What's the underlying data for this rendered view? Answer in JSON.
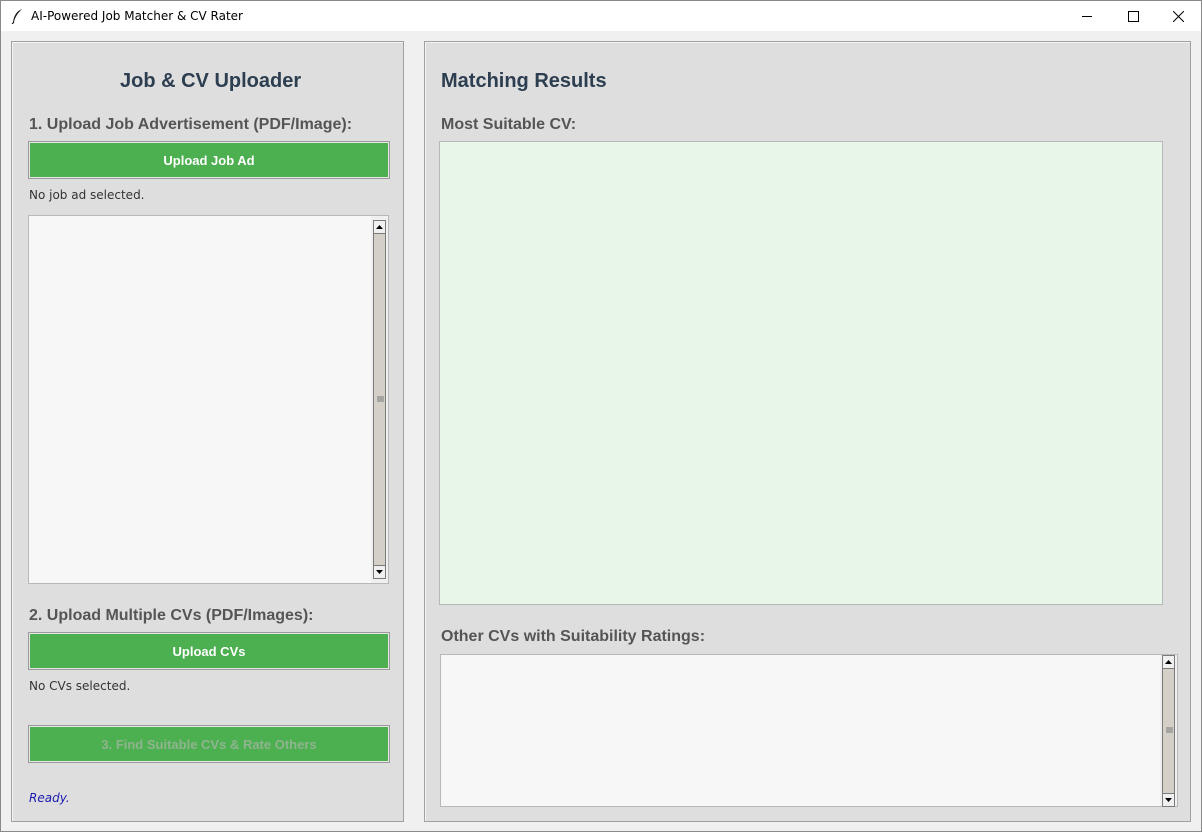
{
  "window": {
    "title": "AI-Powered Job Matcher & CV Rater",
    "app_icon": "feather-icon",
    "controls": [
      "minimize-icon",
      "maximize-icon",
      "close-icon"
    ]
  },
  "left_panel": {
    "title": "Job & CV Uploader",
    "step1_label": "1. Upload Job Advertisement (PDF/Image):",
    "upload_job_button": "Upload Job Ad",
    "job_status": "No job ad selected.",
    "job_preview_text": "",
    "step2_label": "2. Upload Multiple CVs (PDF/Images):",
    "upload_cvs_button": "Upload CVs",
    "cv_status": "No CVs selected.",
    "find_button": "3. Find Suitable CVs & Rate Others",
    "status_text": "Ready."
  },
  "right_panel": {
    "title": "Matching Results",
    "most_suitable_label": "Most Suitable CV:",
    "most_suitable_text": "",
    "other_cvs_label": "Other CVs with Suitability Ratings:",
    "other_cvs_text": ""
  },
  "colors": {
    "button_green": "#4caf50",
    "heading_color": "#2c3e50",
    "label_color": "#555555",
    "result_bg": "#e7f6e8",
    "status_color": "#1a1ab0"
  }
}
